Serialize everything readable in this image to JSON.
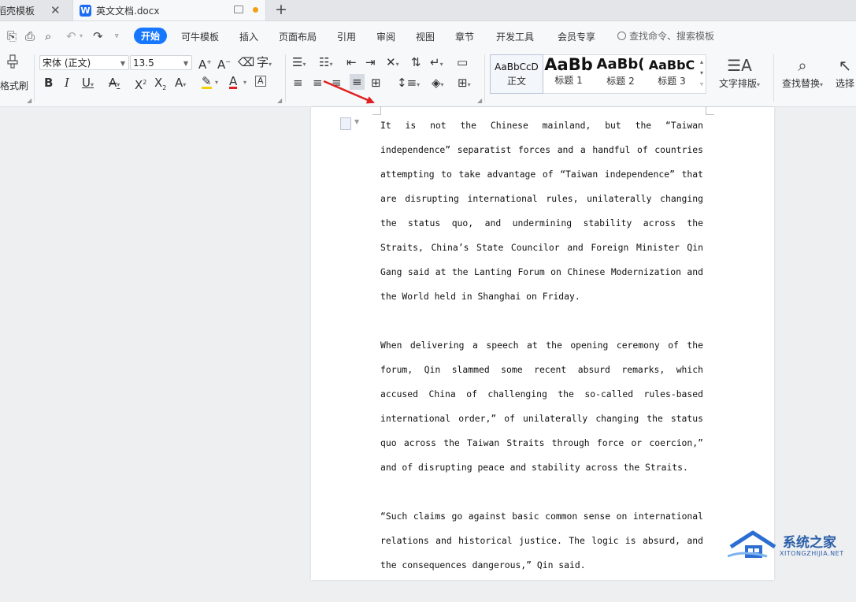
{
  "tabs": [
    {
      "label": "稻壳模板",
      "active": false
    },
    {
      "label": "英文文档.docx",
      "active": true,
      "app_logo": "W"
    }
  ],
  "menu": {
    "items": [
      "开始",
      "可牛模板",
      "插入",
      "页面布局",
      "引用",
      "审阅",
      "视图",
      "章节",
      "开发工具",
      "会员专享"
    ],
    "active": "开始",
    "search_label": "查找命令、搜索模板"
  },
  "ribbon": {
    "format_brush_label": "格式刷",
    "font_name": "宋体 (正文)",
    "font_size": "13.5",
    "styles": [
      {
        "sample": "AaBbCcD",
        "name": "正文"
      },
      {
        "sample": "AaBb",
        "name": "标题 1"
      },
      {
        "sample": "AaBb(",
        "name": "标题 2"
      },
      {
        "sample": "AaBbC",
        "name": "标题 3"
      }
    ],
    "text_layout_label": "文字排版",
    "find_replace_label": "查找替换",
    "select_label": "选择"
  },
  "document": {
    "paragraphs": [
      "It is not the Chinese mainland, but the “Taiwan independence” separatist forces and a handful of countries attempting to take advantage of “Taiwan independence” that are disrupting international rules, unilaterally changing the status quo, and undermining stability across the Straits, China’s State Councilor and Foreign Minister Qin Gang said at the Lanting Forum on Chinese Modernization and the World held in Shanghai on Friday.",
      "When delivering a speech at the opening ceremony of the forum, Qin slammed some recent absurd remarks, which accused China of challenging the so-called rules-based international order,” of unilaterally changing the status quo across the Taiwan Straits through force or coercion,” and of disrupting peace and stability across the Straits.",
      "“Such claims go against basic common sense on international relations and historical justice. The logic is absurd, and the consequences dangerous,” Qin said."
    ]
  },
  "watermark": {
    "title": "系统之家",
    "url": "XITONGZHIJIA.NET"
  },
  "colors": {
    "accent": "#1677ff",
    "arrow": "#e02020",
    "watermark": "#2c5fa8"
  }
}
